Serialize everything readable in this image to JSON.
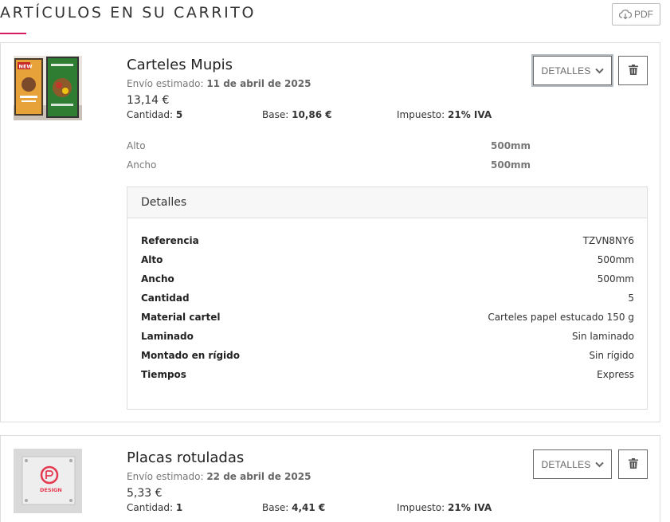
{
  "header": {
    "title": "ARTÍCULOS EN SU CARRITO",
    "pdf_label": "PDF",
    "accent_color": "#d81b60"
  },
  "labels": {
    "shipping_prefix": "Envío estimado:",
    "quantity": "Cantidad:",
    "base": "Base:",
    "tax": "Impuesto:",
    "details_button": "DETALLES",
    "details_panel_title": "Detalles"
  },
  "items": [
    {
      "title": "Carteles Mupis",
      "ship_date": "11 de abril de 2025",
      "price": "13,14 €",
      "quantity": "5",
      "base": "10,86 €",
      "tax": "21% IVA",
      "dimensions": [
        {
          "label": "Alto",
          "value": "500mm"
        },
        {
          "label": "Ancho",
          "value": "500mm"
        }
      ],
      "details": [
        {
          "k": "Referencia",
          "v": "TZVN8NY6"
        },
        {
          "k": "Alto",
          "v": "500mm"
        },
        {
          "k": "Ancho",
          "v": "500mm"
        },
        {
          "k": "Cantidad",
          "v": "5"
        },
        {
          "k": "Material cartel",
          "v": "Carteles papel estucado 150 g"
        },
        {
          "k": "Laminado",
          "v": "Sin laminado"
        },
        {
          "k": "Montado en rígido",
          "v": "Sin rígido"
        },
        {
          "k": "Tiempos",
          "v": "Express"
        }
      ],
      "thumb_text": {
        "badge": "NEW"
      }
    },
    {
      "title": "Placas rotuladas",
      "ship_date": "22 de abril de 2025",
      "price": "5,33 €",
      "quantity": "1",
      "base": "4,41 €",
      "tax": "21% IVA",
      "thumb_text": {
        "logo": "DESIGN"
      }
    }
  ],
  "icons": {
    "pdf": "cloud-download-icon",
    "chevron": "chevron-down-icon",
    "trash": "trash-icon"
  }
}
